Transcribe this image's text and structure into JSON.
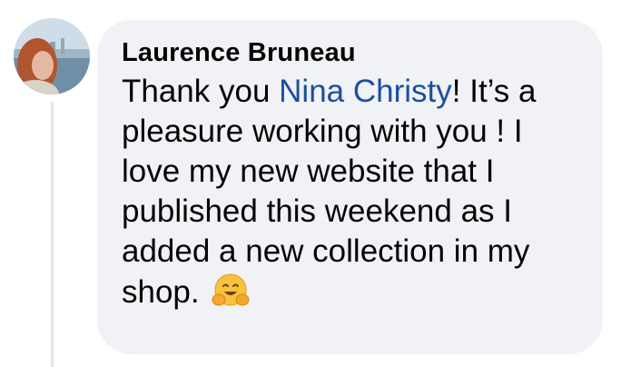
{
  "comment": {
    "author": "Laurence Bruneau",
    "text_before_mention": "Thank you ",
    "mention": "Nina Christy",
    "text_after_mention": "! It’s a pleasure working with you ! I love my new website that I published this weekend as I added a new collection in my shop. ",
    "emoji_icon": "hugging-face-emoji",
    "avatar_icon": "profile-photo"
  },
  "colors": {
    "bubble_background": "#f0f2f5",
    "mention_link": "#1c4fa0",
    "text": "#050505"
  }
}
